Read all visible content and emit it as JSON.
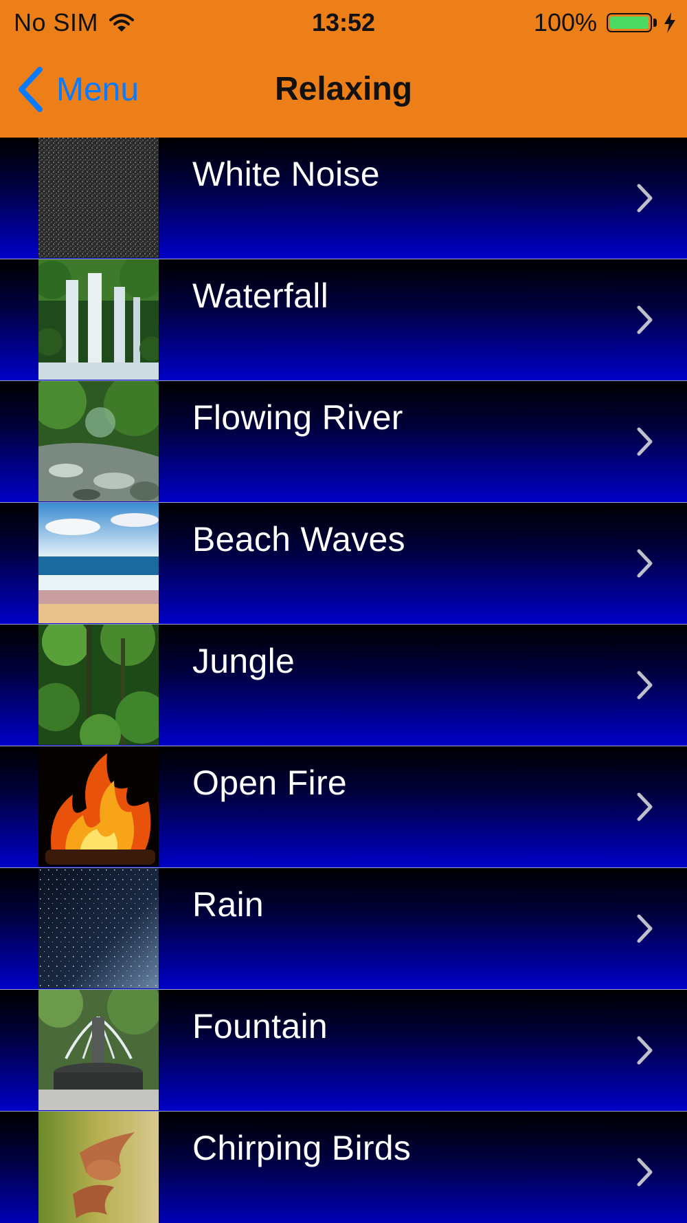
{
  "status_bar": {
    "carrier": "No SIM",
    "time": "13:52",
    "battery": "100%",
    "battery_color": "#4CD964",
    "icons": [
      "wifi-icon",
      "battery-icon",
      "charging-bolt-icon"
    ]
  },
  "nav": {
    "back_label": "Menu",
    "title": "Relaxing",
    "accent_color": "#0A7AFF",
    "bar_color": "#EC7F18"
  },
  "rows": [
    {
      "label": "White Noise",
      "thumb": "white-noise-thumbnail"
    },
    {
      "label": "Waterfall",
      "thumb": "waterfall-thumbnail"
    },
    {
      "label": "Flowing River",
      "thumb": "flowing-river-thumbnail"
    },
    {
      "label": "Beach Waves",
      "thumb": "beach-waves-thumbnail"
    },
    {
      "label": "Jungle",
      "thumb": "jungle-thumbnail"
    },
    {
      "label": "Open Fire",
      "thumb": "open-fire-thumbnail"
    },
    {
      "label": "Rain",
      "thumb": "rain-thumbnail"
    },
    {
      "label": "Fountain",
      "thumb": "fountain-thumbnail"
    },
    {
      "label": "Chirping Birds",
      "thumb": "chirping-birds-thumbnail"
    }
  ]
}
